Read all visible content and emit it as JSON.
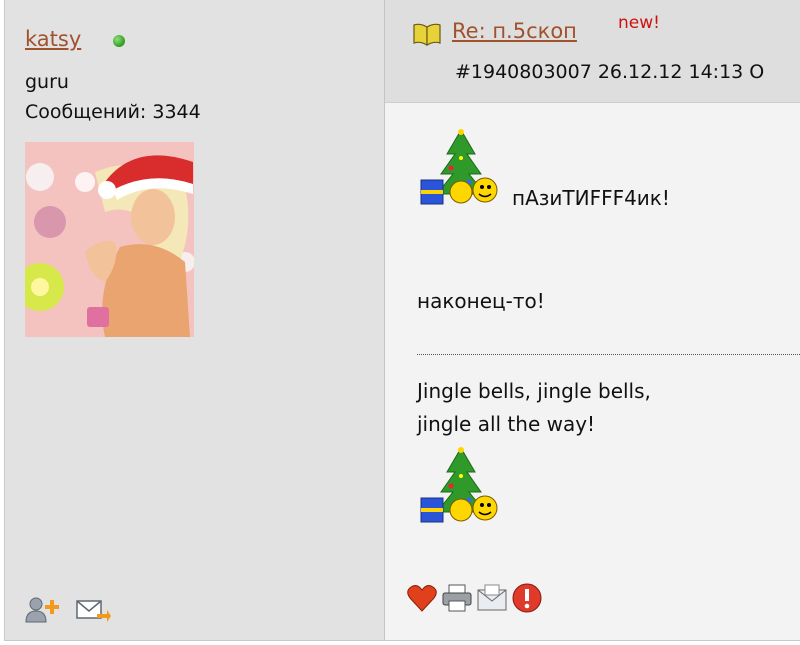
{
  "user": {
    "name": "katsy",
    "rank": "guru",
    "posts_label": "Сообщений: 3344",
    "status_color": "#2e9a1f"
  },
  "post": {
    "title": "Re: п.5скоп",
    "new_badge": "new!",
    "meta": "#1940803007 26.12.12 14:13",
    "meta_overflow": "О",
    "line1": "пАзиТИFFF4ик!",
    "line2": "наконец-то!",
    "signature_line1": "Jingle bells, jingle bells,",
    "signature_line2": "jingle all the way!"
  },
  "icons": {
    "add_friend": "add-user-icon",
    "message": "envelope-arrow-icon",
    "like": "heart-icon",
    "print": "printer-icon",
    "email": "email-icon",
    "report": "warning-icon",
    "topic": "book-icon",
    "smiley": "christmas-tree-smiley-icon"
  },
  "colors": {
    "link": "#a0522d",
    "new": "#cc1111",
    "panel": "#e2e2e2",
    "post_bg": "#f3f3f3",
    "header_bg": "#dedede"
  }
}
